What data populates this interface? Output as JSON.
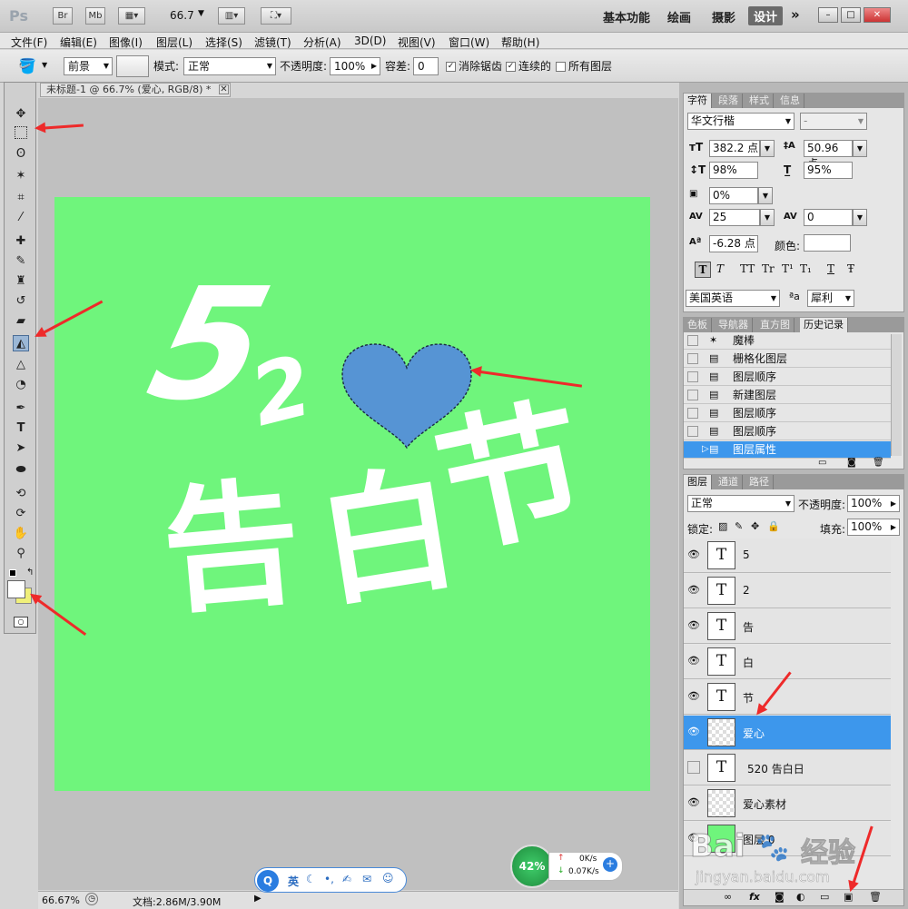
{
  "app": {
    "logo": "Ps",
    "br": "Br",
    "mb": "Mb",
    "zoom": "66.7"
  },
  "workspaces": [
    "基本功能",
    "绘画",
    "摄影",
    "设计"
  ],
  "window_buttons": [
    "–",
    "□",
    "✕"
  ],
  "menu": [
    "文件(F)",
    "编辑(E)",
    "图像(I)",
    "图层(L)",
    "选择(S)",
    "滤镜(T)",
    "分析(A)",
    "3D(D)",
    "视图(V)",
    "窗口(W)",
    "帮助(H)"
  ],
  "options": {
    "fill_source": "前景",
    "mode_label": "模式:",
    "mode_value": "正常",
    "opacity_label": "不透明度:",
    "opacity_value": "100%",
    "tolerance_label": "容差:",
    "tolerance_value": "0",
    "antialias": "消除锯齿",
    "contiguous": "连续的",
    "all_layers": "所有图层"
  },
  "document": {
    "tab_title": "未标题-1 @ 66.7% (爱心, RGB/8) *",
    "close": "✕",
    "canvas_color": "#6ff57c",
    "heart_color": "#5694d4"
  },
  "artwork": {
    "digit5": "5",
    "digit2": "2",
    "char1": "告",
    "char2": "白",
    "char3": "节"
  },
  "status": {
    "zoom": "66.67%",
    "doc_size": "文档:2.86M/3.90M"
  },
  "ime": {
    "label": "英"
  },
  "net_monitor": {
    "percent": "42%",
    "up": "0K/s",
    "down": "0.07K/s"
  },
  "char_panel": {
    "tabs": [
      "字符",
      "段落",
      "样式",
      "信息"
    ],
    "font_family": "华文行楷",
    "font_style": "-",
    "font_size": "382.2 点",
    "leading": "50.96 点",
    "vscale": "98%",
    "hscale": "95%",
    "tracking_pct": "0%",
    "kerning": "25",
    "tracking": "0",
    "baseline": "-6.28 点",
    "color_label": "颜色:",
    "styles": [
      "T",
      "T",
      "TT",
      "Tr",
      "T¹",
      "T₁",
      "T",
      "Ŧ"
    ],
    "language": "美国英语",
    "aa_label": "ªa",
    "antialias": "犀利"
  },
  "history_panel": {
    "tabs": [
      "色板",
      "导航器",
      "直方图",
      "历史记录"
    ],
    "items": [
      "魔棒",
      "栅格化图层",
      "图层顺序",
      "新建图层",
      "图层顺序",
      "图层顺序",
      "图层属性"
    ]
  },
  "layers_panel": {
    "tabs": [
      "图层",
      "通道",
      "路径"
    ],
    "blend_mode": "正常",
    "opacity_label": "不透明度:",
    "opacity": "100%",
    "lock_label": "锁定:",
    "fill_label": "填充:",
    "fill": "100%",
    "layers": [
      {
        "name": "5",
        "visible": true,
        "type": "text"
      },
      {
        "name": "2",
        "visible": true,
        "type": "text"
      },
      {
        "name": "告",
        "visible": true,
        "type": "text"
      },
      {
        "name": "白",
        "visible": true,
        "type": "text"
      },
      {
        "name": "节",
        "visible": true,
        "type": "text"
      },
      {
        "name": "爱心",
        "visible": true,
        "type": "pixel",
        "selected": true
      },
      {
        "name": "520      告白日",
        "visible": false,
        "type": "text"
      },
      {
        "name": "爱心素材",
        "visible": true,
        "type": "pixel"
      },
      {
        "name": "图层 0",
        "visible": true,
        "type": "fill"
      }
    ],
    "footer_icons": [
      "link-icon",
      "fx-icon",
      "mask-icon",
      "adjustment-icon",
      "group-icon",
      "new-layer-icon",
      "trash-icon"
    ]
  },
  "watermark": {
    "brand": "Bai",
    "brand2": "经验",
    "url": "jingyan.baidu.com"
  }
}
